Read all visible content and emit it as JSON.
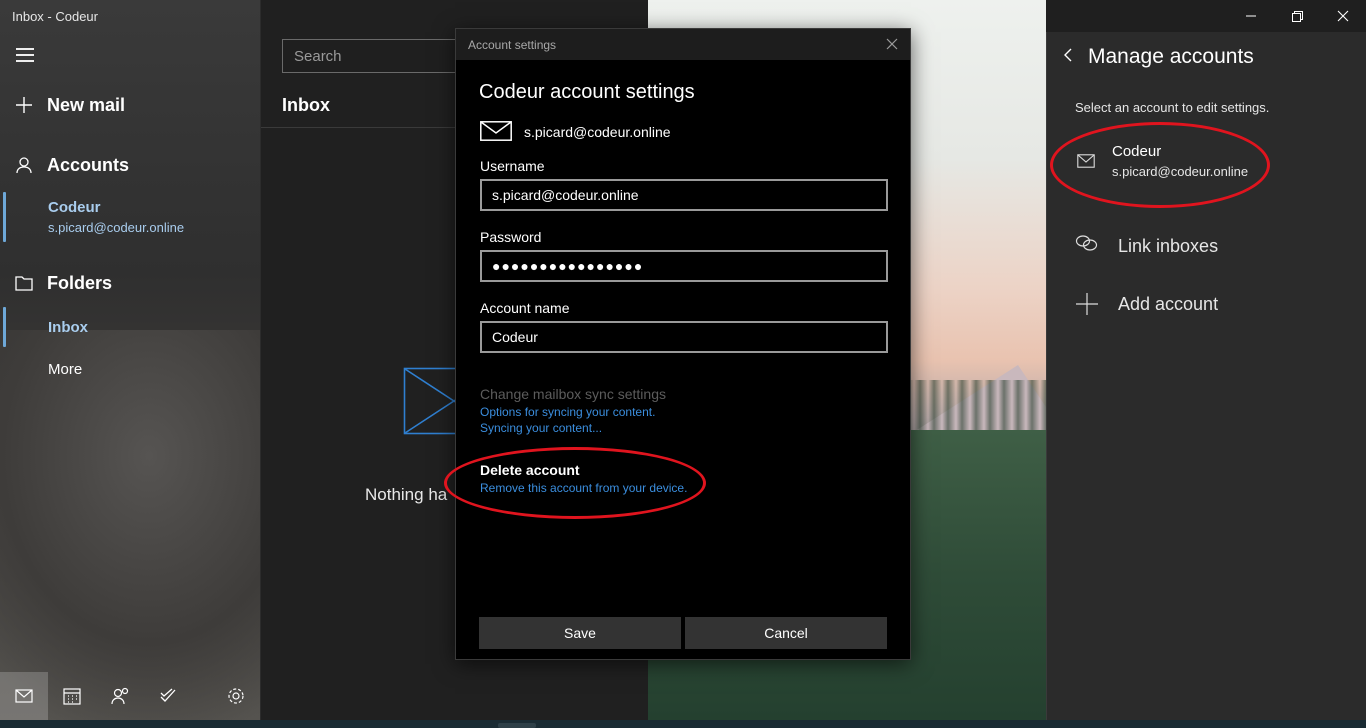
{
  "window": {
    "title": "Inbox - Codeur"
  },
  "nav": {
    "new_mail": "New mail",
    "accounts": "Accounts",
    "account": {
      "name": "Codeur",
      "email": "s.picard@codeur.online"
    },
    "folders": "Folders",
    "folder_inbox": "Inbox",
    "folder_more": "More",
    "bottom_icons": [
      "mail-icon",
      "calendar-icon",
      "people-icon",
      "todo-icon",
      "settings-icon"
    ]
  },
  "list": {
    "search_placeholder": "Search",
    "title": "Inbox",
    "empty_text": "Nothing ha"
  },
  "dialog": {
    "header": "Account settings",
    "title": "Codeur account settings",
    "email": "s.picard@codeur.online",
    "username_label": "Username",
    "username_value": "s.picard@codeur.online",
    "password_label": "Password",
    "password_value": "●●●●●●●●●●●●●●●●",
    "account_name_label": "Account name",
    "account_name_value": "Codeur",
    "sync_title": "Change mailbox sync settings",
    "sync_link1": "Options for syncing your content.",
    "sync_link2": "Syncing your content...",
    "delete_title": "Delete account",
    "delete_link": "Remove this account from your device.",
    "save": "Save",
    "cancel": "Cancel"
  },
  "manage": {
    "title": "Manage accounts",
    "hint": "Select an account to edit settings.",
    "account": {
      "name": "Codeur",
      "email": "s.picard@codeur.online"
    },
    "link_inboxes": "Link inboxes",
    "add_account": "Add account"
  },
  "colors": {
    "accent": "#a9cdee",
    "link": "#3b8ede",
    "annotation": "#e0141e"
  }
}
